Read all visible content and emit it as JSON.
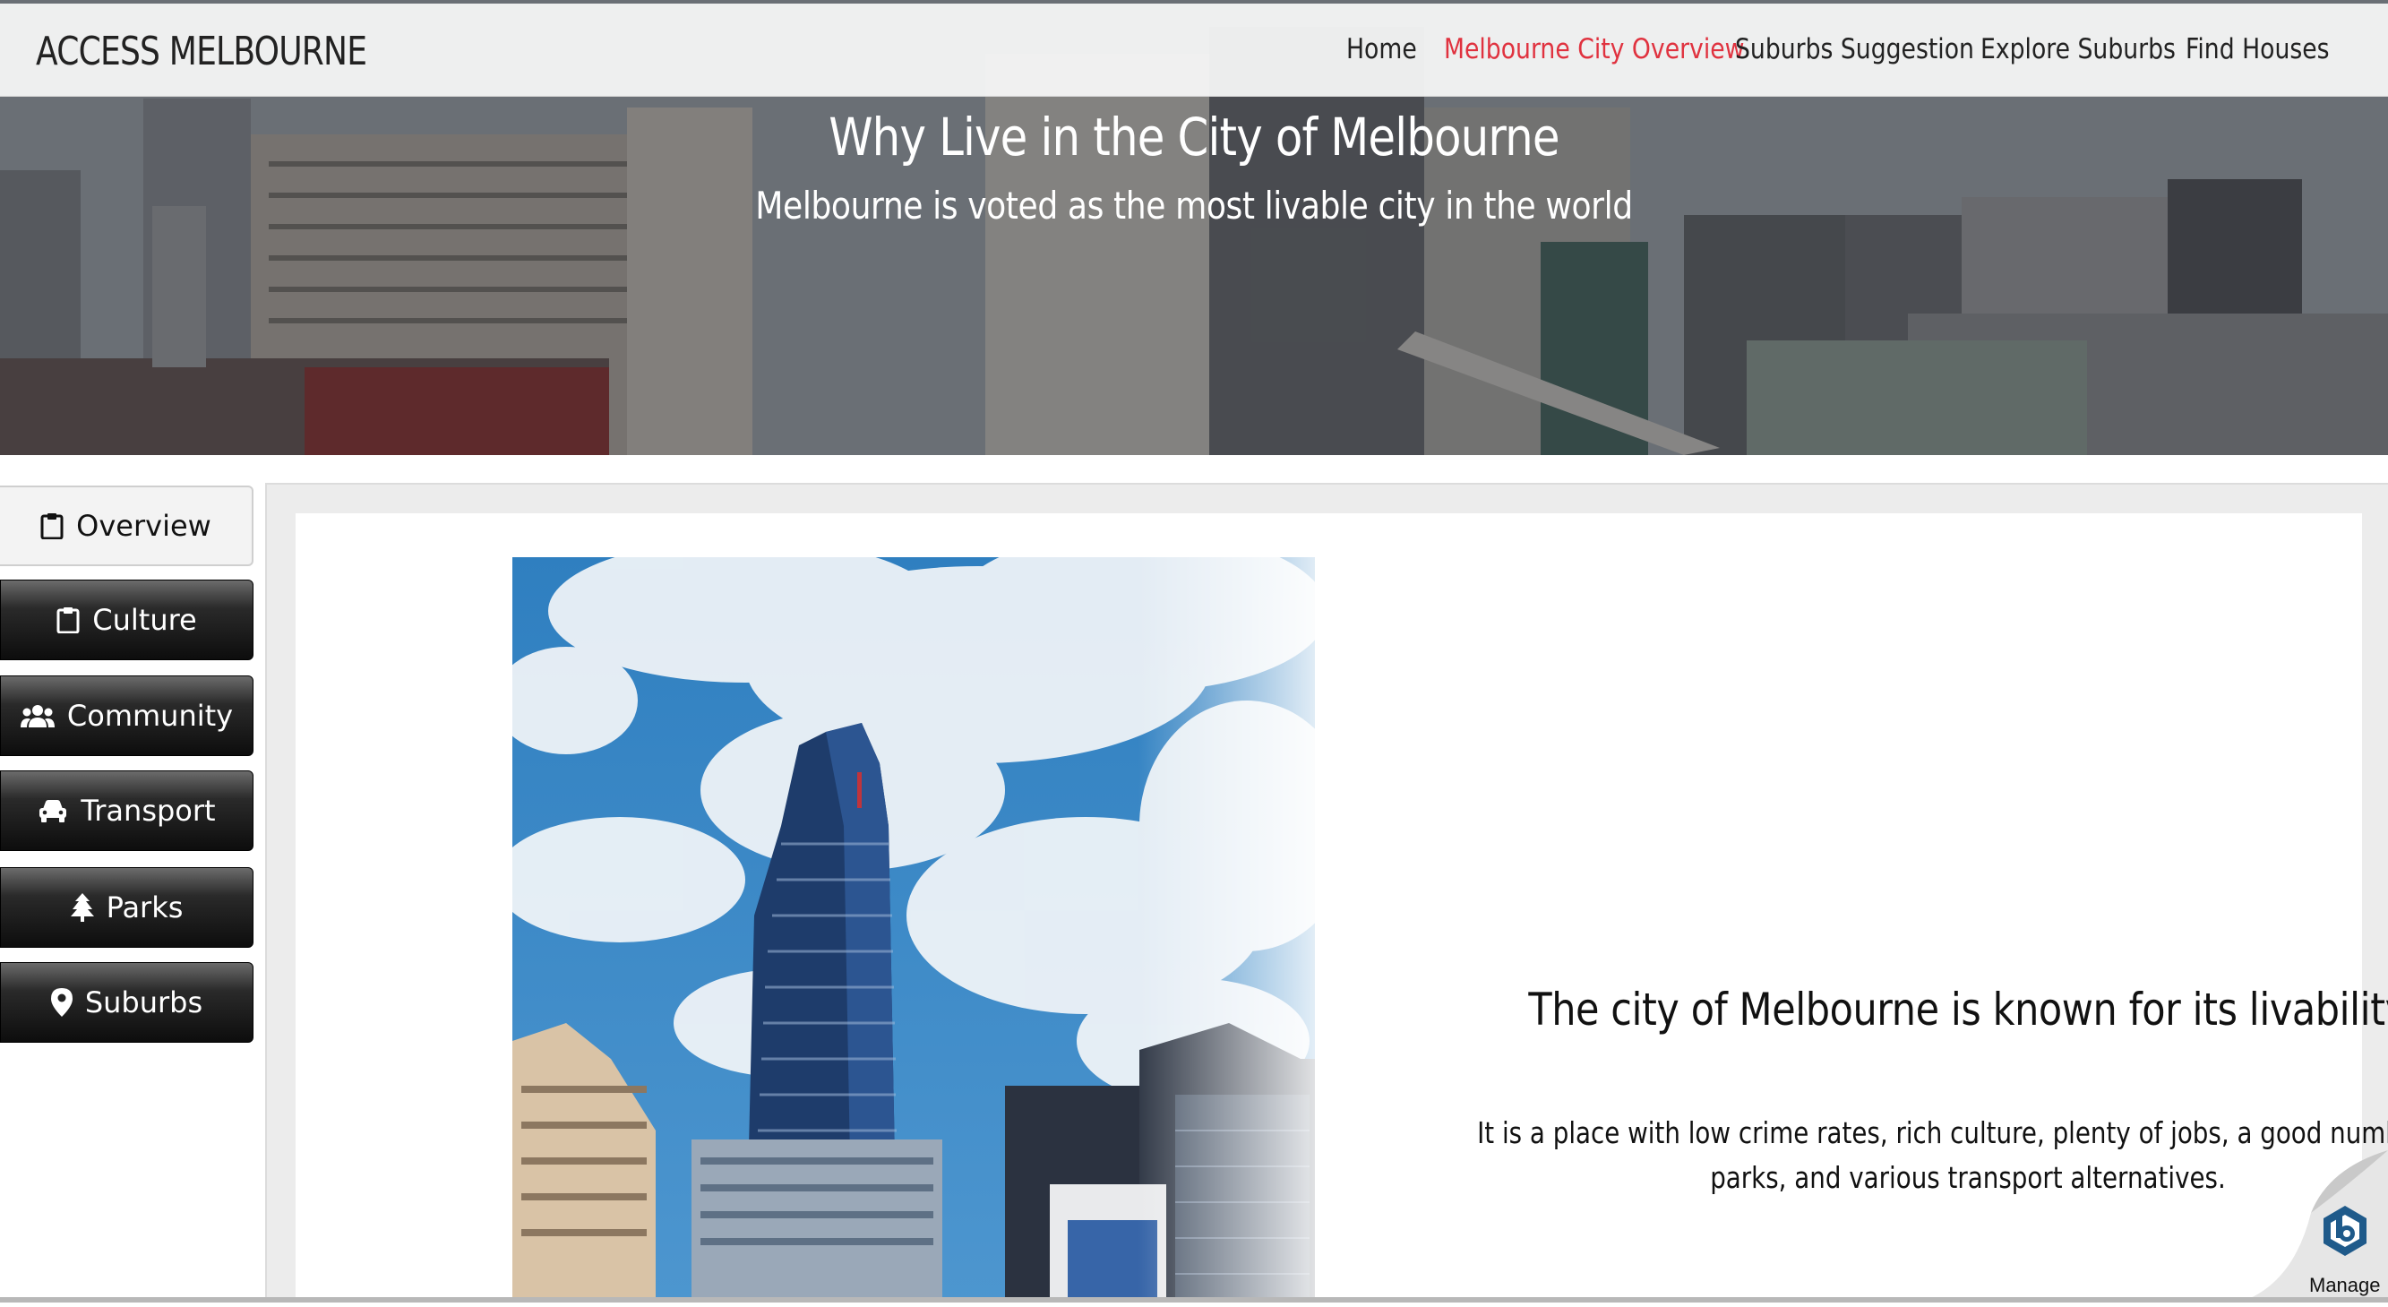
{
  "brand": "ACCESS MELBOURNE",
  "nav": {
    "items": [
      {
        "label": "Home",
        "active": false
      },
      {
        "label": "Melbourne City Overview",
        "active": true
      },
      {
        "label": "Suburbs Suggestion",
        "active": false
      },
      {
        "label": "Explore Suburbs",
        "active": false
      },
      {
        "label": "Find Houses",
        "active": false
      }
    ],
    "active_color": "#e0323f"
  },
  "hero": {
    "title": "Why Live in the City of Melbourne",
    "subtitle": "Melbourne is voted as the most livable city in the world"
  },
  "sidebar": {
    "items": [
      {
        "label": "Overview",
        "icon": "clipboard-icon",
        "selected": true
      },
      {
        "label": "Culture",
        "icon": "clipboard-icon",
        "selected": false
      },
      {
        "label": "Community",
        "icon": "users-icon",
        "selected": false
      },
      {
        "label": "Transport",
        "icon": "car-icon",
        "selected": false
      },
      {
        "label": "Parks",
        "icon": "tree-icon",
        "selected": false
      },
      {
        "label": "Suburbs",
        "icon": "map-marker-icon",
        "selected": false
      }
    ]
  },
  "main": {
    "heading": "The city of Melbourne is known for its livability",
    "body": "It is a place with low crime rates, rich culture, plenty of jobs, a good number of parks, and various transport alternatives."
  },
  "widget": {
    "label": "Manage",
    "icon": "hexagon-b-icon"
  }
}
